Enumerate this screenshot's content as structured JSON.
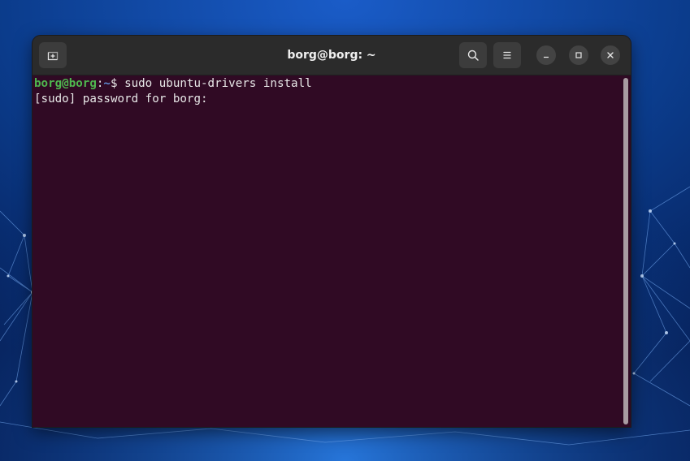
{
  "window": {
    "title": "borg@borg: ~"
  },
  "titlebar": {
    "new_tab_icon": "new-tab-icon",
    "search_icon": "search-icon",
    "menu_icon": "hamburger-menu-icon",
    "minimize_icon": "minimize-icon",
    "maximize_icon": "maximize-icon",
    "close_icon": "close-icon"
  },
  "terminal": {
    "prompt_user": "borg@borg",
    "prompt_colon": ":",
    "prompt_path": "~",
    "prompt_symbol": "$ ",
    "command": "sudo ubuntu-drivers install",
    "output_line": "[sudo] password for borg: "
  },
  "colors": {
    "terminal_bg": "#300a24",
    "titlebar_bg": "#2b2b2b",
    "prompt_user": "#4fb84f",
    "prompt_path": "#5f8fd6"
  }
}
